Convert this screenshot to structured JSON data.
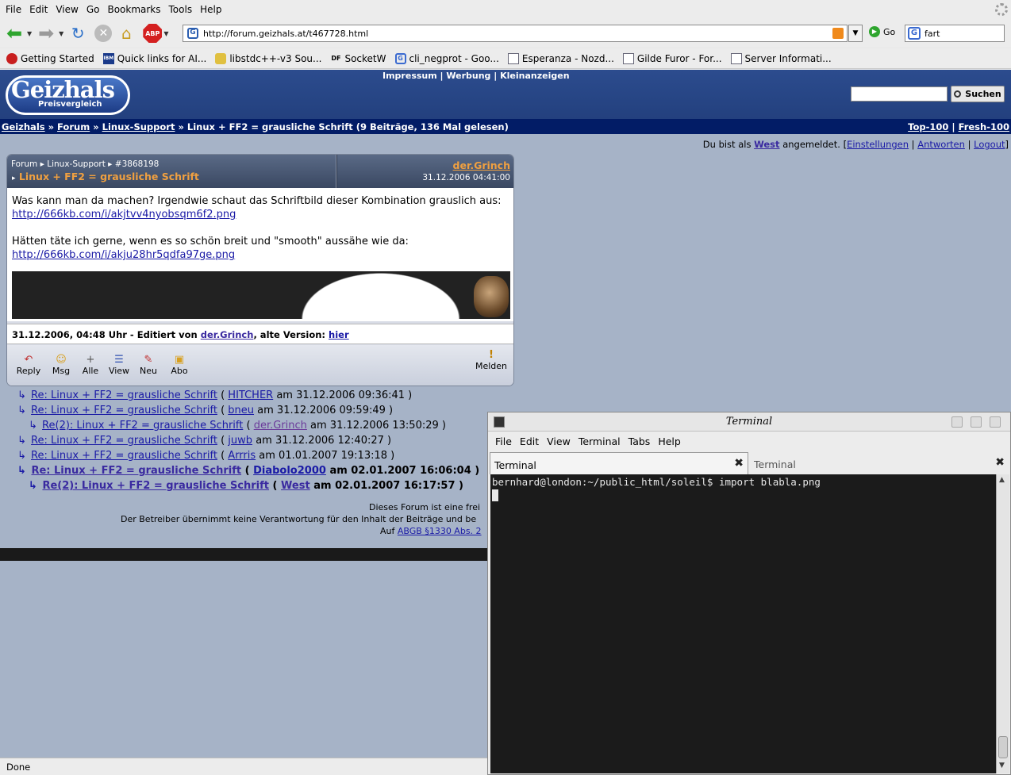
{
  "browser": {
    "menu": [
      "File",
      "Edit",
      "View",
      "Go",
      "Bookmarks",
      "Tools",
      "Help"
    ],
    "abp_label": "ABP",
    "url": "http://forum.geizhals.at/t467728.html",
    "go_label": "Go",
    "search_value": "fart",
    "bookmarks": [
      "Getting Started",
      "Quick links for AI...",
      "libstdc++-v3 Sou...",
      "SocketW",
      "cli_negprot - Goo...",
      "Esperanza - Nozd...",
      "Gilde Furor - For...",
      "Server Informati..."
    ],
    "bookmark_icon_labels": [
      "IBM",
      "DF"
    ],
    "status": "Done"
  },
  "site": {
    "logo_big": "Geizhals",
    "logo_small": "Preisvergleich",
    "top_links": [
      "Impressum",
      "Werbung",
      "Kleinanzeigen"
    ],
    "search_button": "Suchen",
    "breadcrumb": {
      "links": [
        "Geizhals",
        "Forum",
        "Linux-Support"
      ],
      "title": "Linux + FF2 = grausliche Schrift (9 Beiträge, 136 Mal gelesen)",
      "right": [
        "Top-100",
        "Fresh-100"
      ]
    },
    "login": {
      "prefix": "Du bist als",
      "user": "West",
      "suffix": "angemeldet. [",
      "links": [
        "Einstellungen",
        "Antworten",
        "Logout"
      ]
    }
  },
  "post": {
    "crumb": [
      "Forum",
      "Linux-Support",
      "#3868198"
    ],
    "title": "Linux + FF2 = grausliche Schrift",
    "author": "der.Grinch",
    "date": "31.12.2006 04:41:00",
    "line1": "Was kann man da machen? Irgendwie schaut das Schriftbild dieser Kombination grauslich aus:",
    "link1": "http://666kb.com/i/akjtvv4nyobsqm6f2.png",
    "line2": "Hätten täte ich gerne, wenn es so schön breit und \"smooth\" aussähe wie da:",
    "link2": "http://666kb.com/i/akju28hr5qdfa97ge.png",
    "edit_prefix": "31.12.2006, 04:48 Uhr - Editiert von",
    "edit_user": "der.Grinch",
    "edit_mid": ", alte Version:",
    "edit_link": "hier",
    "actions": [
      "Reply",
      "Msg",
      "Alle",
      "View",
      "Neu",
      "Abo"
    ],
    "report": "Melden"
  },
  "replies": [
    {
      "title": "Re: Linux + FF2 = grausliche Schrift",
      "user": "HITCHER",
      "date": "am 31.12.2006 09:36:41 )"
    },
    {
      "title": "Re: Linux + FF2 = grausliche Schrift",
      "user": "bneu",
      "date": "am 31.12.2006 09:59:49 )"
    },
    {
      "title": "Re(2): Linux + FF2 = grausliche Schrift",
      "user": "der.Grinch",
      "date": "am 31.12.2006 13:50:29 )"
    },
    {
      "title": "Re: Linux + FF2 = grausliche Schrift",
      "user": "juwb",
      "date": "am 31.12.2006 12:40:27 )"
    },
    {
      "title": "Re: Linux + FF2 = grausliche Schrift",
      "user": "Arrris",
      "date": "am 01.01.2007 19:13:18 )"
    },
    {
      "title": "Re: Linux + FF2 = grausliche Schrift",
      "user": "Diabolo2000",
      "date": "am 02.01.2007 16:06:04 )"
    },
    {
      "title": "Re(2): Linux + FF2 = grausliche Schrift",
      "user": "West",
      "date": "am 02.01.2007 16:17:57 )"
    }
  ],
  "reply_open": "(",
  "disclaimer": {
    "line1": "Dieses Forum ist eine frei",
    "line2": "Der Betreiber übernimmt keine Verantwortung für den Inhalt der Beiträge und be",
    "line3_prefix": "Auf",
    "line3_link": "ABGB §1330 Abs. 2"
  },
  "terminal": {
    "title": "Terminal",
    "menu": [
      "File",
      "Edit",
      "View",
      "Terminal",
      "Tabs",
      "Help"
    ],
    "tabs": [
      "Terminal",
      "Terminal"
    ],
    "prompt": "bernhard@london:~/public_html/soleil$ import blabla.png"
  }
}
